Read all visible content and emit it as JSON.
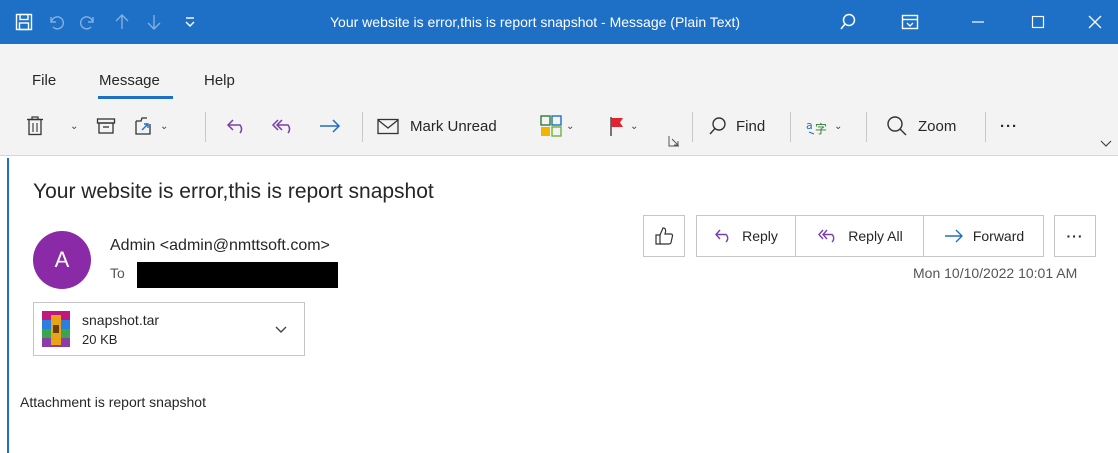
{
  "window": {
    "title": "Your website is error,this is report snapshot  -  Message (Plain Text)"
  },
  "menu": {
    "items": [
      {
        "label": "File"
      },
      {
        "label": "Message"
      },
      {
        "label": "Help"
      }
    ],
    "active": "Message"
  },
  "ribbon": {
    "mark_unread": "Mark Unread",
    "find": "Find",
    "zoom": "Zoom",
    "more": "···"
  },
  "message": {
    "subject": "Your website is error,this is report snapshot",
    "avatar_initial": "A",
    "avatar_color": "#8b2aa6",
    "from": "Admin <admin@nmttsoft.com>",
    "to_label": "To",
    "datetime": "Mon 10/10/2022 10:01 AM",
    "body": "Attachment is  report snapshot"
  },
  "actions": {
    "reply": "Reply",
    "reply_all": "Reply All",
    "forward": "Forward",
    "more": "···"
  },
  "attachment": {
    "name": "snapshot.tar",
    "size": "20 KB"
  },
  "colors": {
    "accent": "#1e6fc6"
  }
}
